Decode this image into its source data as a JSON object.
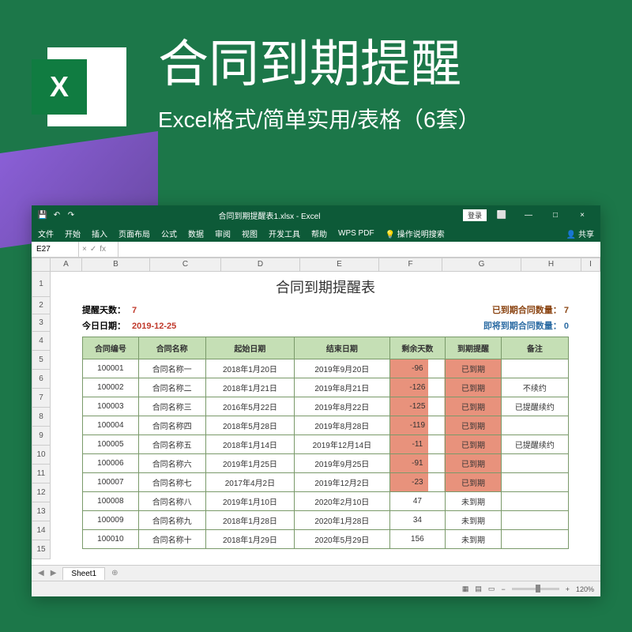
{
  "banner": {
    "logo_letter": "X",
    "title": "合同到期提醒",
    "subtitle": "Excel格式/简单实用/表格（6套）"
  },
  "titlebar": {
    "filename": "合同到期提醒表1.xlsx - Excel",
    "login": "登录",
    "minimize": "—",
    "maximize": "□",
    "close": "×"
  },
  "ribbon": {
    "tabs": [
      "文件",
      "开始",
      "插入",
      "页面布局",
      "公式",
      "数据",
      "审阅",
      "视图",
      "开发工具",
      "帮助",
      "WPS PDF"
    ],
    "tell_me": "操作说明搜索",
    "share": "共享"
  },
  "formula": {
    "name_box": "E27",
    "fx": "fx"
  },
  "columns": [
    "A",
    "B",
    "C",
    "D",
    "E",
    "F",
    "G",
    "H",
    "I"
  ],
  "rows": [
    "1",
    "2",
    "3",
    "4",
    "5",
    "6",
    "7",
    "8",
    "9",
    "10",
    "11",
    "12",
    "13",
    "14",
    "15"
  ],
  "sheet": {
    "title": "合同到期提醒表",
    "reminder_days_label": "提醒天数：",
    "reminder_days": "7",
    "today_label": "今日日期：",
    "today": "2019-12-25",
    "expired_count_label": "已到期合同数量：",
    "expired_count": "7",
    "upcoming_count_label": "即将到期合同数量：",
    "upcoming_count": "0",
    "headers": [
      "合同编号",
      "合同名称",
      "起始日期",
      "结束日期",
      "剩余天数",
      "到期提醒",
      "备注"
    ],
    "data": [
      {
        "id": "100001",
        "name": "合同名称一",
        "start": "2018年1月20日",
        "end": "2019年9月20日",
        "days": "-96",
        "status": "已到期",
        "note": ""
      },
      {
        "id": "100002",
        "name": "合同名称二",
        "start": "2018年1月21日",
        "end": "2019年8月21日",
        "days": "-126",
        "status": "已到期",
        "note": "不续约"
      },
      {
        "id": "100003",
        "name": "合同名称三",
        "start": "2016年5月22日",
        "end": "2019年8月22日",
        "days": "-125",
        "status": "已到期",
        "note": "已提醒续约"
      },
      {
        "id": "100004",
        "name": "合同名称四",
        "start": "2018年5月28日",
        "end": "2019年8月28日",
        "days": "-119",
        "status": "已到期",
        "note": ""
      },
      {
        "id": "100005",
        "name": "合同名称五",
        "start": "2018年1月14日",
        "end": "2019年12月14日",
        "days": "-11",
        "status": "已到期",
        "note": "已提醒续约"
      },
      {
        "id": "100006",
        "name": "合同名称六",
        "start": "2019年1月25日",
        "end": "2019年9月25日",
        "days": "-91",
        "status": "已到期",
        "note": ""
      },
      {
        "id": "100007",
        "name": "合同名称七",
        "start": "2017年4月2日",
        "end": "2019年12月2日",
        "days": "-23",
        "status": "已到期",
        "note": ""
      },
      {
        "id": "100008",
        "name": "合同名称八",
        "start": "2019年1月10日",
        "end": "2020年2月10日",
        "days": "47",
        "status": "未到期",
        "note": ""
      },
      {
        "id": "100009",
        "name": "合同名称九",
        "start": "2018年1月28日",
        "end": "2020年1月28日",
        "days": "34",
        "status": "未到期",
        "note": ""
      },
      {
        "id": "100010",
        "name": "合同名称十",
        "start": "2018年1月29日",
        "end": "2020年5月29日",
        "days": "156",
        "status": "未到期",
        "note": ""
      }
    ],
    "tab_name": "Sheet1"
  },
  "statusbar": {
    "zoom": "120%"
  }
}
